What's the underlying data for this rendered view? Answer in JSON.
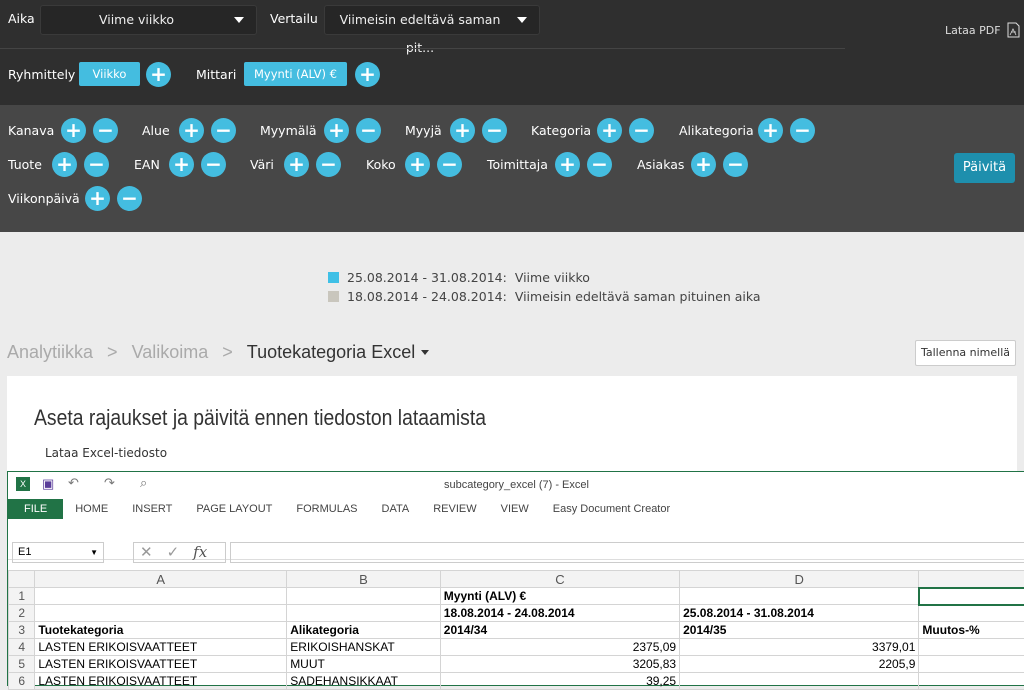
{
  "header": {
    "aika_label": "Aika",
    "aika_value": "Viime viikko",
    "vertailu_label": "Vertailu",
    "vertailu_value": "Viimeisin edeltävä saman pit...",
    "pdf_label": "Lataa PDF",
    "ryhmittely_label": "Ryhmittely",
    "ryhmittely_value": "Viikko",
    "mittari_label": "Mittari",
    "mittari_value": "Myynti (ALV) €"
  },
  "filters": [
    {
      "label": "Kanava"
    },
    {
      "label": "Alue"
    },
    {
      "label": "Myymälä"
    },
    {
      "label": "Myyjä"
    },
    {
      "label": "Kategoria"
    },
    {
      "label": "Alikategoria"
    },
    {
      "label": "Tuote"
    },
    {
      "label": "EAN"
    },
    {
      "label": "Väri"
    },
    {
      "label": "Koko"
    },
    {
      "label": "Toimittaja"
    },
    {
      "label": "Asiakas"
    },
    {
      "label": "Viikonpäivä"
    }
  ],
  "update_button": "Päivitä",
  "legend": [
    {
      "range": "25.08.2014 - 31.08.2014:",
      "name": "Viime viikko",
      "color": "#3fc0e6"
    },
    {
      "range": "18.08.2014 - 24.08.2014:",
      "name": "Viimeisin edeltävä saman pituinen aika",
      "color": "#c9c6bd"
    }
  ],
  "breadcrumb": [
    "Analytiikka",
    "Valikoima",
    "Tuotekategoria Excel"
  ],
  "save_button": "Tallenna nimellä",
  "card": {
    "title": "Aseta rajaukset ja päivitä ennen tiedoston lataamista",
    "link": "Lataa Excel-tiedosto"
  },
  "excel": {
    "title": "subcategory_excel (7) - Excel",
    "tabs": [
      "FILE",
      "HOME",
      "INSERT",
      "PAGE LAYOUT",
      "FORMULAS",
      "DATA",
      "REVIEW",
      "VIEW",
      "Easy Document Creator"
    ],
    "namebox": "E1",
    "fx": "fx",
    "columns": [
      "A",
      "B",
      "C",
      "D",
      ""
    ],
    "rows": [
      {
        "n": "1",
        "a": "",
        "b": "",
        "c": "Myynti (ALV) €",
        "d": "",
        "e": ""
      },
      {
        "n": "2",
        "a": "",
        "b": "",
        "c": "18.08.2014 - 24.08.2014",
        "d": "25.08.2014 - 31.08.2014",
        "e": ""
      },
      {
        "n": "3",
        "a": "Tuotekategoria",
        "b": "Alikategoria",
        "c": "2014/34",
        "d": "2014/35",
        "e": "Muutos-%"
      },
      {
        "n": "4",
        "a": "LASTEN ERIKOISVAATTEET",
        "b": "ERIKOISHANSKAT",
        "c": "2375,09",
        "d": "3379,01",
        "e": ""
      },
      {
        "n": "5",
        "a": "LASTEN ERIKOISVAATTEET",
        "b": "MUUT",
        "c": "3205,83",
        "d": "2205,9",
        "e": ""
      },
      {
        "n": "6",
        "a": "LASTEN ERIKOISVAATTEET",
        "b": "SADEHANSIKKAAT",
        "c": "39,25",
        "d": "",
        "e": ""
      }
    ]
  }
}
